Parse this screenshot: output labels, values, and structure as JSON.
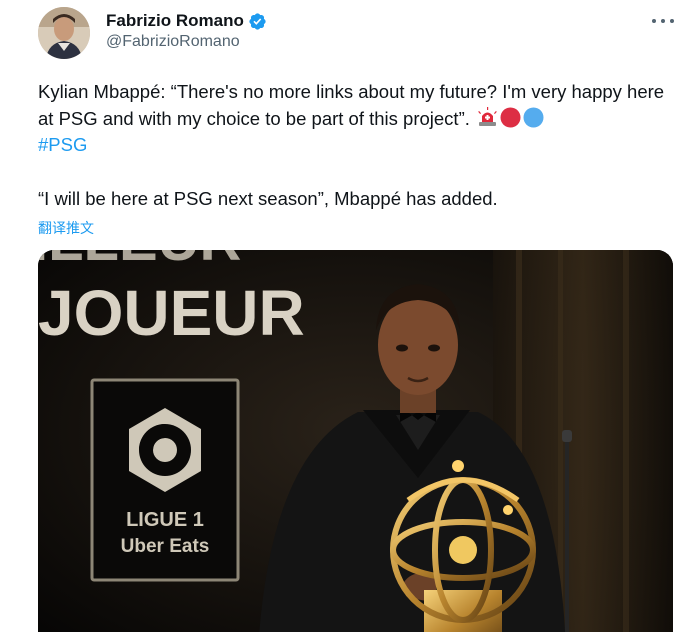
{
  "tweet": {
    "author": {
      "name": "Fabrizio Romano",
      "handle": "@FabrizioRomano",
      "verified": true
    },
    "text_part1": "Kylian Mbappé: “There's no more links about my future? I'm very happy here at PSG and with my choice to be part of this project”.",
    "hashtag": "#PSG",
    "text_part2": "“I will be here at PSG next season”, Mbappé has added.",
    "translate_label": "翻译推文",
    "emojis": [
      "siren-emoji",
      "red-circle-emoji",
      "blue-circle-emoji"
    ],
    "media": {
      "backdrop_text": "MEILLEUR JOUEUR",
      "logo_line1": "LIGUE 1",
      "logo_line2": "Uber Eats"
    }
  },
  "colors": {
    "link": "#1d9bf0",
    "text": "#0f1419",
    "secondary": "#536471",
    "verified": "#1d9bf0"
  }
}
